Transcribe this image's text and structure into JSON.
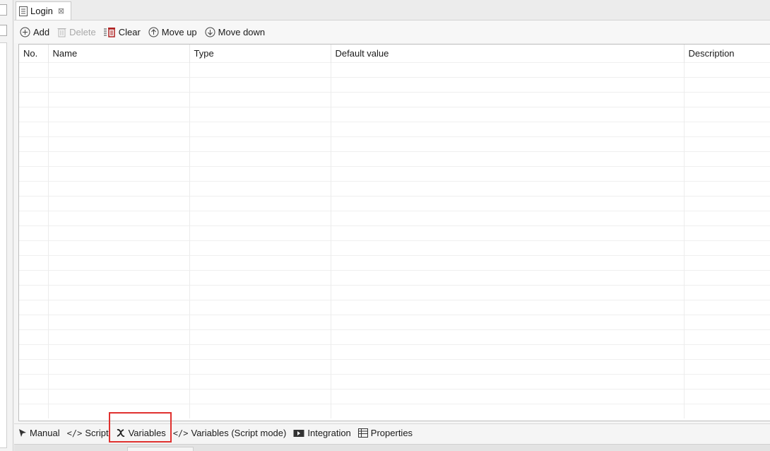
{
  "tab": {
    "title": "Login",
    "close_glyph": "⊠"
  },
  "toolbar": {
    "add_label": "Add",
    "delete_label": "Delete",
    "clear_label": "Clear",
    "move_up_label": "Move up",
    "move_down_label": "Move down"
  },
  "table": {
    "columns": [
      "No.",
      "Name",
      "Type",
      "Default value",
      "Description"
    ],
    "rows": []
  },
  "bottom_tabs": {
    "manual": "Manual",
    "script": "Script",
    "variables": "Variables",
    "variables_script": "Variables (Script mode)",
    "integration": "Integration",
    "properties": "Properties"
  },
  "icons": {
    "tab": "document-icon",
    "add": "plus-circle-icon",
    "delete": "trash-icon",
    "clear": "clear-list-icon",
    "move_up": "arrow-up-circle-icon",
    "move_down": "arrow-down-circle-icon",
    "manual": "cursor-icon",
    "script": "code-icon",
    "variables": "variable-x-icon",
    "integration": "integration-icon",
    "properties": "table-icon"
  },
  "colors": {
    "highlight": "#e0312f",
    "clear_icon": "#b02222"
  }
}
